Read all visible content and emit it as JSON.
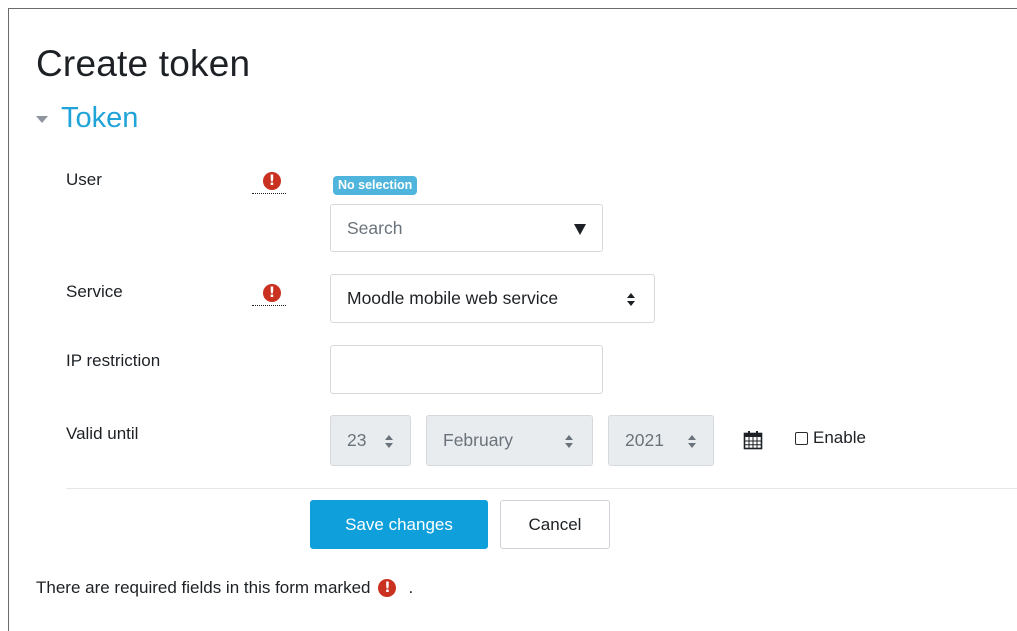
{
  "page": {
    "title": "Create token"
  },
  "section": {
    "title": "Token"
  },
  "fields": {
    "user": {
      "label": "User",
      "badge": "No selection",
      "search_placeholder": "Search"
    },
    "service": {
      "label": "Service",
      "selected": "Moodle mobile web service"
    },
    "ip_restriction": {
      "label": "IP restriction",
      "value": ""
    },
    "valid_until": {
      "label": "Valid until",
      "day": "23",
      "month": "February",
      "year": "2021",
      "enable_label": "Enable",
      "enabled": false
    }
  },
  "buttons": {
    "save": "Save changes",
    "cancel": "Cancel"
  },
  "footer": {
    "required_note": "There are required fields in this form marked",
    "trailing": "."
  },
  "icons": {
    "required": "exclamation-circle-icon",
    "section_toggle": "caret-down-icon",
    "calendar": "calendar-icon"
  },
  "colors": {
    "accent": "#1fa3d8",
    "primary_button": "#0fa0dc",
    "required": "#ca3120",
    "badge": "#4fb5dc"
  }
}
